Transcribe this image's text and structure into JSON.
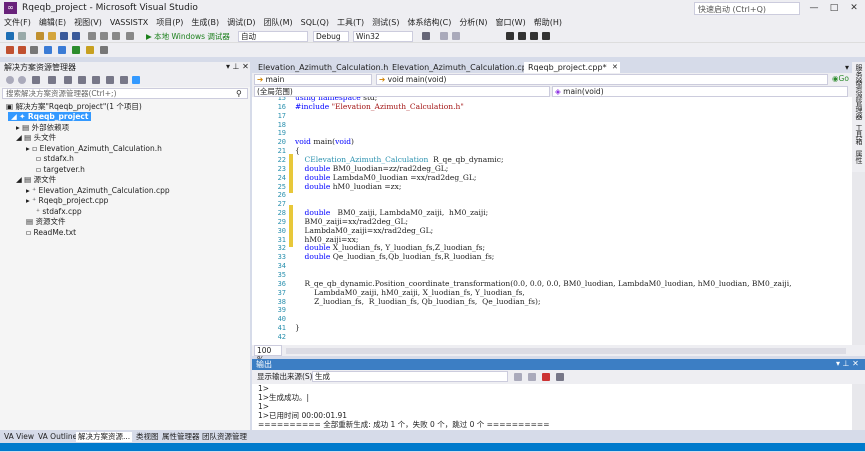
{
  "window": {
    "title": "Rqeqb_project - Microsoft Visual Studio",
    "quick_launch_placeholder": "快速启动 (Ctrl+Q)"
  },
  "menu": [
    "文件(F)",
    "编辑(E)",
    "视图(V)",
    "VASSISTX",
    "项目(P)",
    "生成(B)",
    "调试(D)",
    "团队(M)",
    "SQL(Q)",
    "工具(T)",
    "测试(S)",
    "体系结构(C)",
    "分析(N)",
    "窗口(W)",
    "帮助(H)"
  ],
  "toolbar": {
    "run_label": "▶ 本地 Windows 调试器",
    "config_auto": "自动",
    "config": "Debug",
    "platform": "Win32"
  },
  "solution_explorer": {
    "title": "解决方案资源管理器",
    "search_placeholder": "搜索解决方案资源管理器(Ctrl+;)",
    "items": [
      {
        "label": "解决方案\"Rqeqb_project\"(1 个项目)"
      },
      {
        "label": "Rqeqb_project"
      },
      {
        "label": "外部依赖项"
      },
      {
        "label": "头文件"
      },
      {
        "label": "Elevation_Azimuth_Calculation.h"
      },
      {
        "label": "stdafx.h"
      },
      {
        "label": "targetver.h"
      },
      {
        "label": "源文件"
      },
      {
        "label": "Elevation_Azimuth_Calculation.cpp"
      },
      {
        "label": "Rqeqb_project.cpp"
      },
      {
        "label": "stdafx.cpp"
      },
      {
        "label": "资源文件"
      },
      {
        "label": "ReadMe.txt"
      }
    ]
  },
  "editor": {
    "tabs": [
      "Elevation_Azimuth_Calculation.h",
      "Elevation_Azimuth_Calculation.cpp",
      "Rqeqb_project.cpp*"
    ],
    "nav_scope": "main",
    "nav_member": "void main(void)",
    "nav_scope2": "(全局范围)",
    "nav_member2": "main(void)",
    "zoom": "100 %",
    "lines": [
      {
        "n": "15",
        "t": "using namespace std;"
      },
      {
        "n": "16",
        "t": "#include \"Elevation_Azimuth_Calculation.h\""
      },
      {
        "n": "17",
        "t": ""
      },
      {
        "n": "18",
        "t": ""
      },
      {
        "n": "19",
        "t": ""
      },
      {
        "n": "20",
        "t": "void main(void)"
      },
      {
        "n": "21",
        "t": "{"
      },
      {
        "n": "22",
        "t": "    CElevation_Azimuth_Calculation  R_qe_qb_dynamic;"
      },
      {
        "n": "23",
        "t": "    double BM0_luodian=zz/rad2deg_GL;"
      },
      {
        "n": "24",
        "t": "    double LambdaM0_luodian =xx/rad2deg_GL;"
      },
      {
        "n": "25",
        "t": "    double hM0_luodian =zx;"
      },
      {
        "n": "26",
        "t": ""
      },
      {
        "n": "27",
        "t": ""
      },
      {
        "n": "28",
        "t": "    double   BM0_zaiji, LambdaM0_zaiji,  hM0_zaiji;"
      },
      {
        "n": "29",
        "t": "    BM0_zaiji=xx/rad2deg_GL;"
      },
      {
        "n": "30",
        "t": "    LambdaM0_zaiji=xx/rad2deg_GL;"
      },
      {
        "n": "31",
        "t": "    hM0_zaiji=xx;"
      },
      {
        "n": "32",
        "t": "    double X_luodian_fs, Y_luodian_fs,Z_luodian_fs;"
      },
      {
        "n": "33",
        "t": "    double Qe_luodian_fs,Qb_luodian_fs,R_luodian_fs;"
      },
      {
        "n": "34",
        "t": ""
      },
      {
        "n": "35",
        "t": ""
      },
      {
        "n": "36",
        "t": "    R_qe_qb_dynamic.Position_coordinate_transformation(0.0, 0.0, 0.0, BM0_luodian, LambdaM0_luodian, hM0_luodian, BM0_zaiji,"
      },
      {
        "n": "37",
        "t": "        LambdaM0_zaiji, hM0_zaiji, X_luodian_fs, Y_luodian_fs,"
      },
      {
        "n": "38",
        "t": "        Z_luodian_fs,  R_luodian_fs, Qb_luodian_fs,  Qe_luodian_fs);"
      },
      {
        "n": "39",
        "t": ""
      },
      {
        "n": "40",
        "t": ""
      },
      {
        "n": "41",
        "t": "}"
      },
      {
        "n": "42",
        "t": ""
      }
    ]
  },
  "output": {
    "title": "输出",
    "source_label": "显示输出来源(S):",
    "source_value": "生成",
    "lines": [
      "1>",
      "1>生成成功。|",
      "1>",
      "1>已用时间 00:00:01.91",
      "========== 全部重新生成: 成功 1 个，失败 0 个，跳过 0 个 =========="
    ]
  },
  "bottom_tabs": [
    "VA View",
    "VA Outline",
    "解决方案资源...",
    "类视图",
    "属性管理器",
    "团队资源管理器"
  ],
  "right_dock": [
    "服务器资源管理器",
    "工具箱",
    "属性"
  ],
  "colors": {
    "accent": "#007acc",
    "keyword": "#0000ff",
    "string": "#a31515",
    "type": "#2b91af",
    "selection": "#3399ff"
  }
}
